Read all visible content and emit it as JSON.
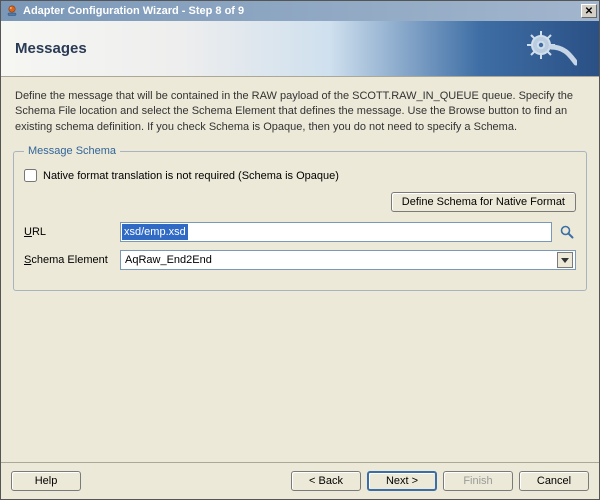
{
  "title": "Adapter Configuration Wizard - Step 8 of 9",
  "banner": {
    "heading": "Messages"
  },
  "description": "Define the message that will be contained in the RAW payload of the SCOTT.RAW_IN_QUEUE queue.  Specify the Schema File location and select the Schema Element that defines the message. Use the Browse button to find an existing schema definition. If you check Schema is Opaque, then you do not need to specify a Schema.",
  "schema": {
    "legend": "Message Schema",
    "opaque_label": "Native format translation is not required (Schema is Opaque)",
    "define_native_btn": "Define Schema for Native Format",
    "url_label_accel": "U",
    "url_label_rest": "RL",
    "url_value": "xsd/emp.xsd",
    "element_label_accel": "S",
    "element_label_rest": "chema Element",
    "element_value": "AqRaw_End2End"
  },
  "buttons": {
    "help": "Help",
    "back": "< Back",
    "next": "Next >",
    "finish": "Finish",
    "cancel": "Cancel"
  }
}
